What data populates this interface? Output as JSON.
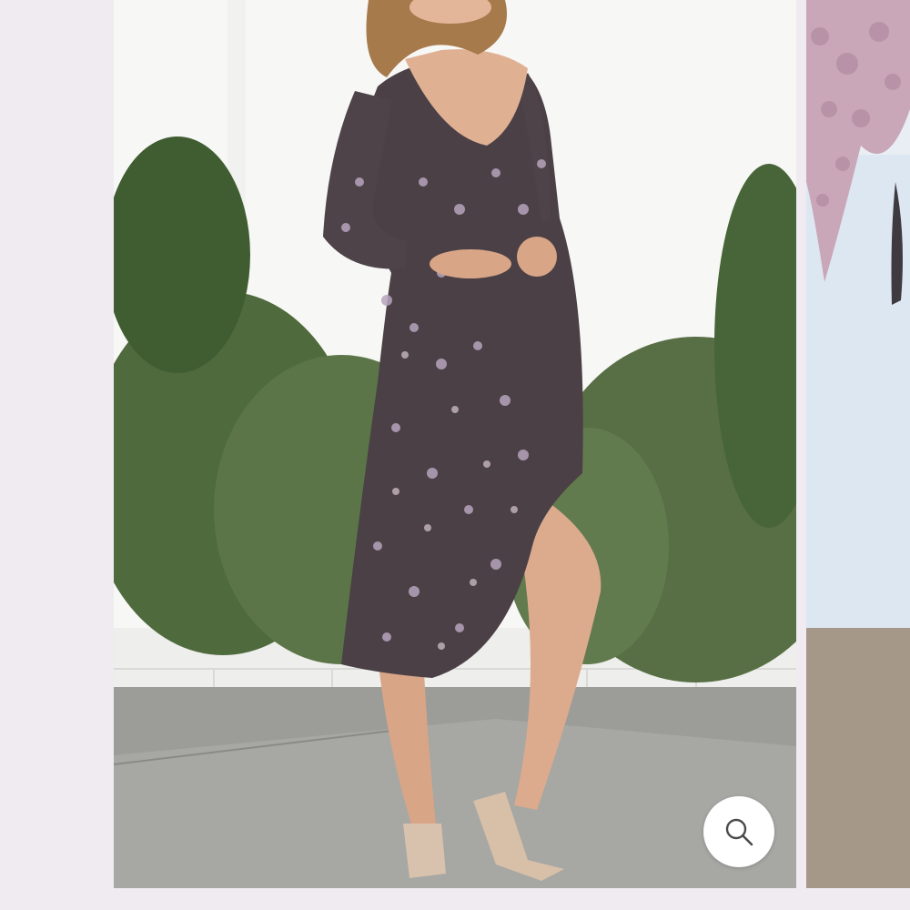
{
  "gallery": {
    "main_image_alt": "",
    "next_image_alt": "",
    "zoom_icon": "search-icon",
    "colors": {
      "page_background": "#efebf1",
      "button_background": "#ffffff",
      "icon": "#4a4a4a"
    }
  }
}
